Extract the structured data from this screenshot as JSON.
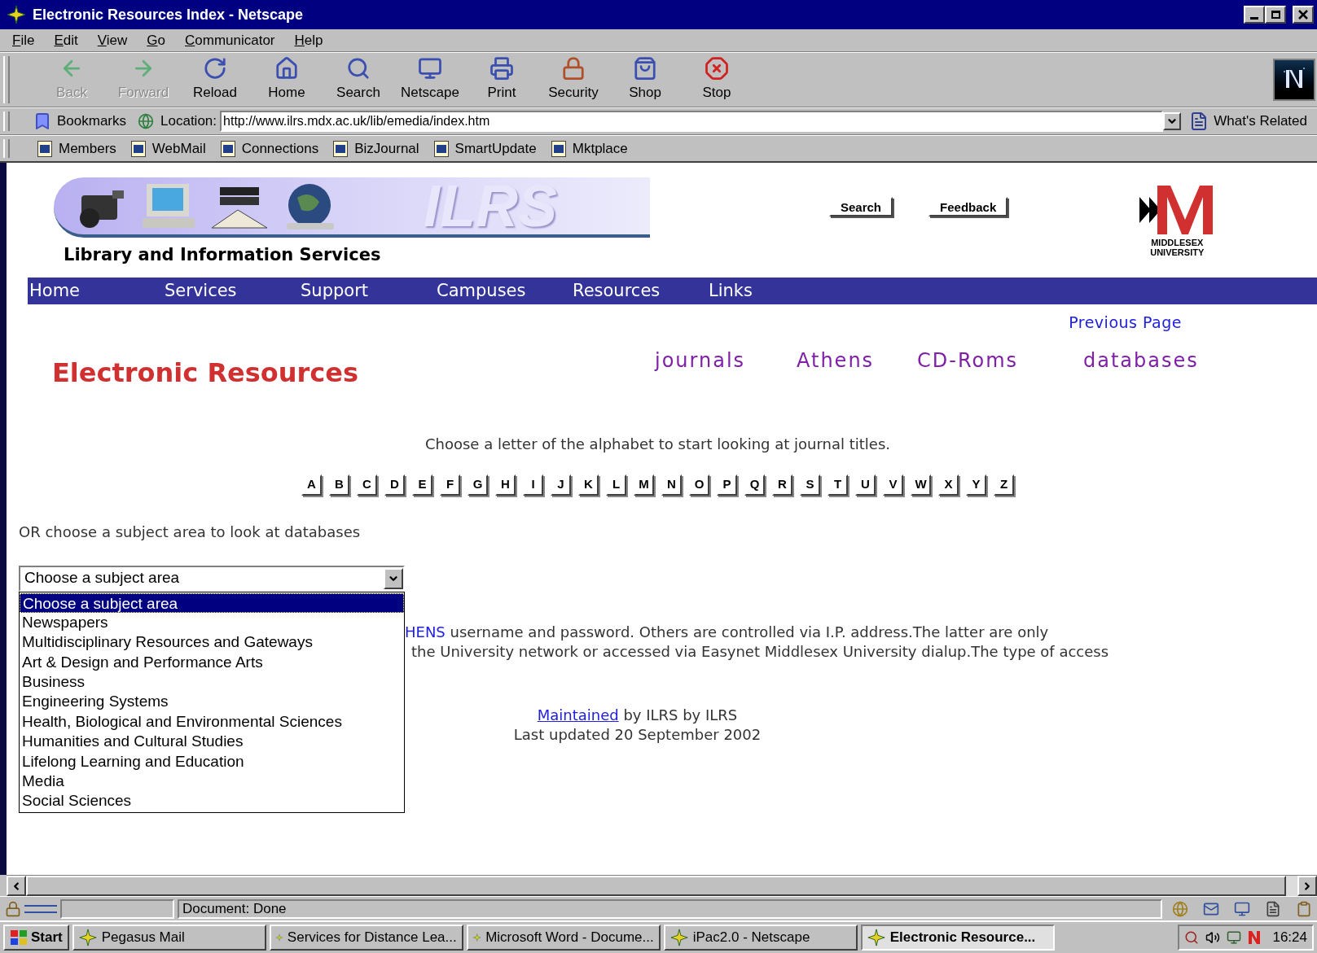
{
  "window": {
    "title": "Electronic Resources Index - Netscape"
  },
  "menu": [
    "File",
    "Edit",
    "View",
    "Go",
    "Communicator",
    "Help"
  ],
  "toolbar": [
    {
      "label": "Back",
      "kind": "back",
      "disabled": true
    },
    {
      "label": "Forward",
      "kind": "forward",
      "disabled": true
    },
    {
      "label": "Reload",
      "kind": "reload",
      "disabled": false
    },
    {
      "label": "Home",
      "kind": "home",
      "disabled": false
    },
    {
      "label": "Search",
      "kind": "search",
      "disabled": false
    },
    {
      "label": "Netscape",
      "kind": "netscape",
      "disabled": false
    },
    {
      "label": "Print",
      "kind": "print",
      "disabled": false
    },
    {
      "label": "Security",
      "kind": "security",
      "disabled": false
    },
    {
      "label": "Shop",
      "kind": "shop",
      "disabled": false
    },
    {
      "label": "Stop",
      "kind": "stop",
      "disabled": false
    }
  ],
  "location_bar": {
    "bookmarks": "Bookmarks",
    "label": "Location:",
    "url": "http://www.ilrs.mdx.ac.uk/lib/emedia/index.htm",
    "related": "What's Related"
  },
  "personal_toolbar": [
    "Members",
    "WebMail",
    "Connections",
    "BizJournal",
    "SmartUpdate",
    "Mktplace"
  ],
  "page": {
    "banner_text": "ILRS",
    "subtitle": "Library and Information Services",
    "header_buttons": [
      "Search",
      "Feedback"
    ],
    "logo_text": [
      "MIDDLESEX",
      "UNIVERSITY"
    ],
    "nav": [
      "Home",
      "Services",
      "Support",
      "Campuses",
      "Resources",
      "Links"
    ],
    "previous_page": "Previous Page",
    "heading": "Electronic Resources",
    "quick_links": [
      "journals",
      "Athens",
      "CD-Roms",
      "databases"
    ],
    "instruction": "Choose a letter of the alphabet to start looking at journal titles.",
    "letters": [
      "A",
      "B",
      "C",
      "D",
      "E",
      "F",
      "G",
      "H",
      "I",
      "J",
      "K",
      "L",
      "M",
      "N",
      "O",
      "P",
      "Q",
      "R",
      "S",
      "T",
      "U",
      "V",
      "W",
      "X",
      "Y",
      "Z"
    ],
    "subject_prompt": "OR choose a subject area to look at databases",
    "subject_select": {
      "value": "Choose a subject area",
      "options": [
        {
          "label": "Choose a subject area",
          "selected": true
        },
        {
          "label": "Newspapers",
          "selected": false
        },
        {
          "label": "Multidisciplinary Resources and Gateways",
          "selected": false
        },
        {
          "label": "Art & Design and Performance Arts",
          "selected": false
        },
        {
          "label": "Business",
          "selected": false
        },
        {
          "label": "Engineering Systems",
          "selected": false
        },
        {
          "label": "Health, Biological and Environmental Sciences",
          "selected": false
        },
        {
          "label": "Humanities and Cultural Studies",
          "selected": false
        },
        {
          "label": "Lifelong Learning and Education",
          "selected": false
        },
        {
          "label": "Media",
          "selected": false
        },
        {
          "label": "Social Sciences",
          "selected": false
        }
      ]
    },
    "notice": {
      "link": "HENS",
      "line_1": "username and password. Others are controlled via I.P. address.The latter are only",
      "line_2": "the University network or accessed via Easynet Middlesex University dialup.The type of access"
    },
    "footer": {
      "link": "Maintained",
      "text": "by ILRS by ILRS",
      "updated": "Last updated 20 September 2002"
    }
  },
  "status_bar": {
    "text": "Document: Done"
  },
  "taskbar": {
    "start": "Start",
    "tasks": [
      {
        "label": "Pegasus Mail",
        "selected": false
      },
      {
        "label": "Services for Distance Lea...",
        "selected": false
      },
      {
        "label": "Microsoft Word - Docume...",
        "selected": false
      },
      {
        "label": "iPac2.0 - Netscape",
        "selected": false
      },
      {
        "label": "Electronic Resource...",
        "selected": true
      }
    ],
    "clock": "16:24"
  }
}
